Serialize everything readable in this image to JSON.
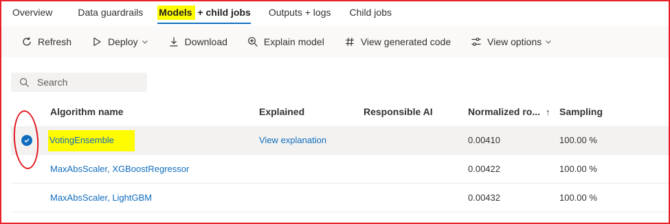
{
  "tabs": [
    {
      "label_highlight": "Models",
      "label_rest": " + child jobs"
    },
    {
      "label": "Overview"
    },
    {
      "label": "Data guardrails"
    },
    {
      "label": "Outputs + logs"
    },
    {
      "label": "Child jobs"
    }
  ],
  "toolbar": {
    "refresh": "Refresh",
    "deploy": "Deploy",
    "download": "Download",
    "explain": "Explain model",
    "view_code": "View generated code",
    "view_options": "View options"
  },
  "search": {
    "placeholder": "Search"
  },
  "grid": {
    "headers": {
      "algorithm": "Algorithm name",
      "explained": "Explained",
      "responsible": "Responsible AI",
      "normalized": "Normalized ro...",
      "sort_arrow": "↑",
      "sampling": "Sampling"
    },
    "rows": [
      {
        "algorithm": "VotingEnsemble",
        "explained": "View explanation",
        "responsible": "",
        "normalized": "0.00410",
        "sampling": "100.00 %",
        "selected": true
      },
      {
        "algorithm": "MaxAbsScaler, XGBoostRegressor",
        "explained": "",
        "responsible": "",
        "normalized": "0.00422",
        "sampling": "100.00 %",
        "selected": false
      },
      {
        "algorithm": "MaxAbsScaler, LightGBM",
        "explained": "",
        "responsible": "",
        "normalized": "0.00432",
        "sampling": "100.00 %",
        "selected": false
      }
    ]
  },
  "colors": {
    "accent": "#0f6cbd",
    "highlight": "#fffb00",
    "annotation": "#e3141f"
  }
}
